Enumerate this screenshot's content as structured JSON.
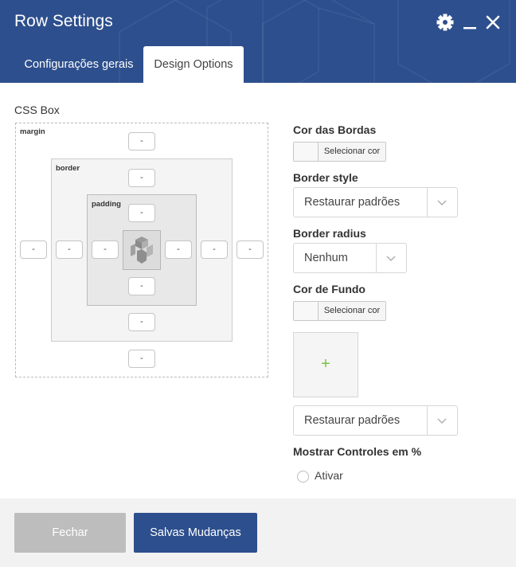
{
  "window": {
    "title": "Row Settings",
    "icons": [
      "gear-icon",
      "minimize-icon",
      "close-icon"
    ]
  },
  "tabs": [
    {
      "label": "Configurações gerais",
      "active": false
    },
    {
      "label": "Design Options",
      "active": true
    }
  ],
  "css_box": {
    "title": "CSS Box",
    "margin_label": "margin",
    "border_label": "border",
    "padding_label": "padding",
    "margin": {
      "top": "-",
      "right": "-",
      "bottom": "-",
      "left": "-"
    },
    "border": {
      "top": "-",
      "right": "-",
      "bottom": "-",
      "left": "-"
    },
    "padding": {
      "top": "-",
      "right": "-",
      "bottom": "-",
      "left": "-"
    },
    "center_icon": "composer-logo-icon"
  },
  "border_color": {
    "label": "Cor das Bordas",
    "button": "Selecionar cor"
  },
  "border_style": {
    "label": "Border style",
    "value": "Restaurar padrões"
  },
  "border_radius": {
    "label": "Border radius",
    "value": "Nenhum"
  },
  "background_color": {
    "label": "Cor de Fundo",
    "button": "Selecionar cor"
  },
  "background_image": {
    "add_symbol": "+"
  },
  "background_style": {
    "value": "Restaurar padrões"
  },
  "percent_controls": {
    "label": "Mostrar Controles em %",
    "checkbox_label": "Ativar",
    "checked": false
  },
  "footer": {
    "close_label": "Fechar",
    "save_label": "Salvas Mudanças"
  },
  "colors": {
    "header": "#2d4f8d",
    "save_button": "#2d4f8d",
    "close_button": "#bdbdbd",
    "plus": "#7cc242"
  }
}
